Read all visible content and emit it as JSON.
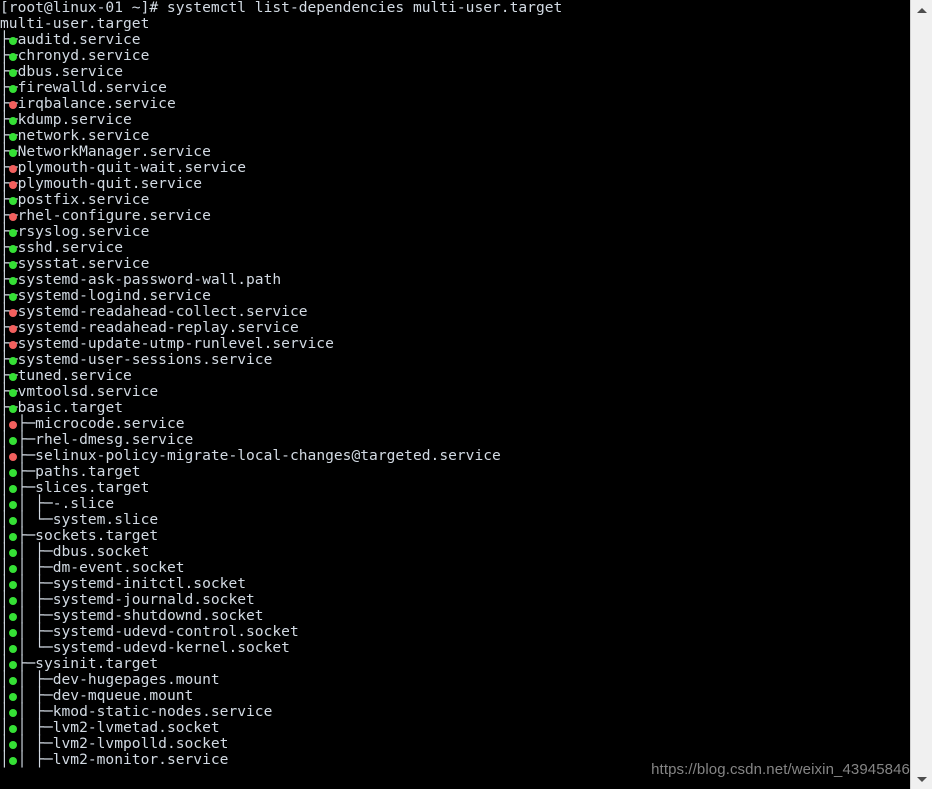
{
  "terminal": {
    "prompt_line": "[root@linux-01 ~]# systemctl list-dependencies multi-user.target",
    "root_line": "multi-user.target",
    "lines": [
      {
        "status": "none",
        "text": "[root@linux-01 ~]# systemctl list-dependencies multi-user.target",
        "indent": 0,
        "prefix": ""
      },
      {
        "status": "none",
        "text": "multi-user.target",
        "indent": 0,
        "prefix": ""
      },
      {
        "status": "ok",
        "text": "auditd.service",
        "indent": 1,
        "prefix": "├─"
      },
      {
        "status": "ok",
        "text": "chronyd.service",
        "indent": 1,
        "prefix": "├─"
      },
      {
        "status": "ok",
        "text": "dbus.service",
        "indent": 1,
        "prefix": "├─"
      },
      {
        "status": "ok",
        "text": "firewalld.service",
        "indent": 1,
        "prefix": "├─"
      },
      {
        "status": "fail",
        "text": "irqbalance.service",
        "indent": 1,
        "prefix": "├─"
      },
      {
        "status": "ok",
        "text": "kdump.service",
        "indent": 1,
        "prefix": "├─"
      },
      {
        "status": "ok",
        "text": "network.service",
        "indent": 1,
        "prefix": "├─"
      },
      {
        "status": "ok",
        "text": "NetworkManager.service",
        "indent": 1,
        "prefix": "├─"
      },
      {
        "status": "fail",
        "text": "plymouth-quit-wait.service",
        "indent": 1,
        "prefix": "├─"
      },
      {
        "status": "fail",
        "text": "plymouth-quit.service",
        "indent": 1,
        "prefix": "├─"
      },
      {
        "status": "ok",
        "text": "postfix.service",
        "indent": 1,
        "prefix": "├─"
      },
      {
        "status": "fail",
        "text": "rhel-configure.service",
        "indent": 1,
        "prefix": "├─"
      },
      {
        "status": "ok",
        "text": "rsyslog.service",
        "indent": 1,
        "prefix": "├─"
      },
      {
        "status": "ok",
        "text": "sshd.service",
        "indent": 1,
        "prefix": "├─"
      },
      {
        "status": "ok",
        "text": "sysstat.service",
        "indent": 1,
        "prefix": "├─"
      },
      {
        "status": "ok",
        "text": "systemd-ask-password-wall.path",
        "indent": 1,
        "prefix": "├─"
      },
      {
        "status": "ok",
        "text": "systemd-logind.service",
        "indent": 1,
        "prefix": "├─"
      },
      {
        "status": "fail",
        "text": "systemd-readahead-collect.service",
        "indent": 1,
        "prefix": "├─"
      },
      {
        "status": "fail",
        "text": "systemd-readahead-replay.service",
        "indent": 1,
        "prefix": "├─"
      },
      {
        "status": "fail",
        "text": "systemd-update-utmp-runlevel.service",
        "indent": 1,
        "prefix": "├─"
      },
      {
        "status": "ok",
        "text": "systemd-user-sessions.service",
        "indent": 1,
        "prefix": "├─"
      },
      {
        "status": "ok",
        "text": "tuned.service",
        "indent": 1,
        "prefix": "├─"
      },
      {
        "status": "ok",
        "text": "vmtoolsd.service",
        "indent": 1,
        "prefix": "├─"
      },
      {
        "status": "ok",
        "text": "basic.target",
        "indent": 1,
        "prefix": "├─"
      },
      {
        "status": "fail",
        "text": "microcode.service",
        "indent": 2,
        "prefix": "│ ├─"
      },
      {
        "status": "ok",
        "text": "rhel-dmesg.service",
        "indent": 2,
        "prefix": "│ ├─"
      },
      {
        "status": "fail",
        "text": "selinux-policy-migrate-local-changes@targeted.service",
        "indent": 2,
        "prefix": "│ ├─"
      },
      {
        "status": "ok",
        "text": "paths.target",
        "indent": 2,
        "prefix": "│ ├─"
      },
      {
        "status": "ok",
        "text": "slices.target",
        "indent": 2,
        "prefix": "│ ├─"
      },
      {
        "status": "ok",
        "text": "-.slice",
        "indent": 3,
        "prefix": "│ │ ├─"
      },
      {
        "status": "ok",
        "text": "system.slice",
        "indent": 3,
        "prefix": "│ │ └─"
      },
      {
        "status": "ok",
        "text": "sockets.target",
        "indent": 2,
        "prefix": "│ ├─"
      },
      {
        "status": "ok",
        "text": "dbus.socket",
        "indent": 3,
        "prefix": "│ │ ├─"
      },
      {
        "status": "ok",
        "text": "dm-event.socket",
        "indent": 3,
        "prefix": "│ │ ├─"
      },
      {
        "status": "ok",
        "text": "systemd-initctl.socket",
        "indent": 3,
        "prefix": "│ │ ├─"
      },
      {
        "status": "ok",
        "text": "systemd-journald.socket",
        "indent": 3,
        "prefix": "│ │ ├─"
      },
      {
        "status": "ok",
        "text": "systemd-shutdownd.socket",
        "indent": 3,
        "prefix": "│ │ ├─"
      },
      {
        "status": "ok",
        "text": "systemd-udevd-control.socket",
        "indent": 3,
        "prefix": "│ │ ├─"
      },
      {
        "status": "ok",
        "text": "systemd-udevd-kernel.socket",
        "indent": 3,
        "prefix": "│ │ └─"
      },
      {
        "status": "ok",
        "text": "sysinit.target",
        "indent": 2,
        "prefix": "│ ├─"
      },
      {
        "status": "ok",
        "text": "dev-hugepages.mount",
        "indent": 3,
        "prefix": "│ │ ├─"
      },
      {
        "status": "ok",
        "text": "dev-mqueue.mount",
        "indent": 3,
        "prefix": "│ │ ├─"
      },
      {
        "status": "ok",
        "text": "kmod-static-nodes.service",
        "indent": 3,
        "prefix": "│ │ ├─"
      },
      {
        "status": "ok",
        "text": "lvm2-lvmetad.socket",
        "indent": 3,
        "prefix": "│ │ ├─"
      },
      {
        "status": "ok",
        "text": "lvm2-lvmpolld.socket",
        "indent": 3,
        "prefix": "│ │ ├─"
      },
      {
        "status": "ok",
        "text": "lvm2-monitor.service",
        "indent": 3,
        "prefix": "│ │ ├─"
      }
    ]
  },
  "watermark": {
    "text": "https://blog.csdn.net/weixin_43945846"
  },
  "scrollbar": {
    "up_arrow": "scroll-up-arrow",
    "down_arrow": "scroll-down-arrow"
  },
  "colors": {
    "background": "#000000",
    "text": "#d2dae3",
    "status_ok": "#35e035",
    "status_fail": "#f2605e",
    "watermark": "#8d8d8d",
    "scrollbar_track": "#f0f0f0"
  }
}
